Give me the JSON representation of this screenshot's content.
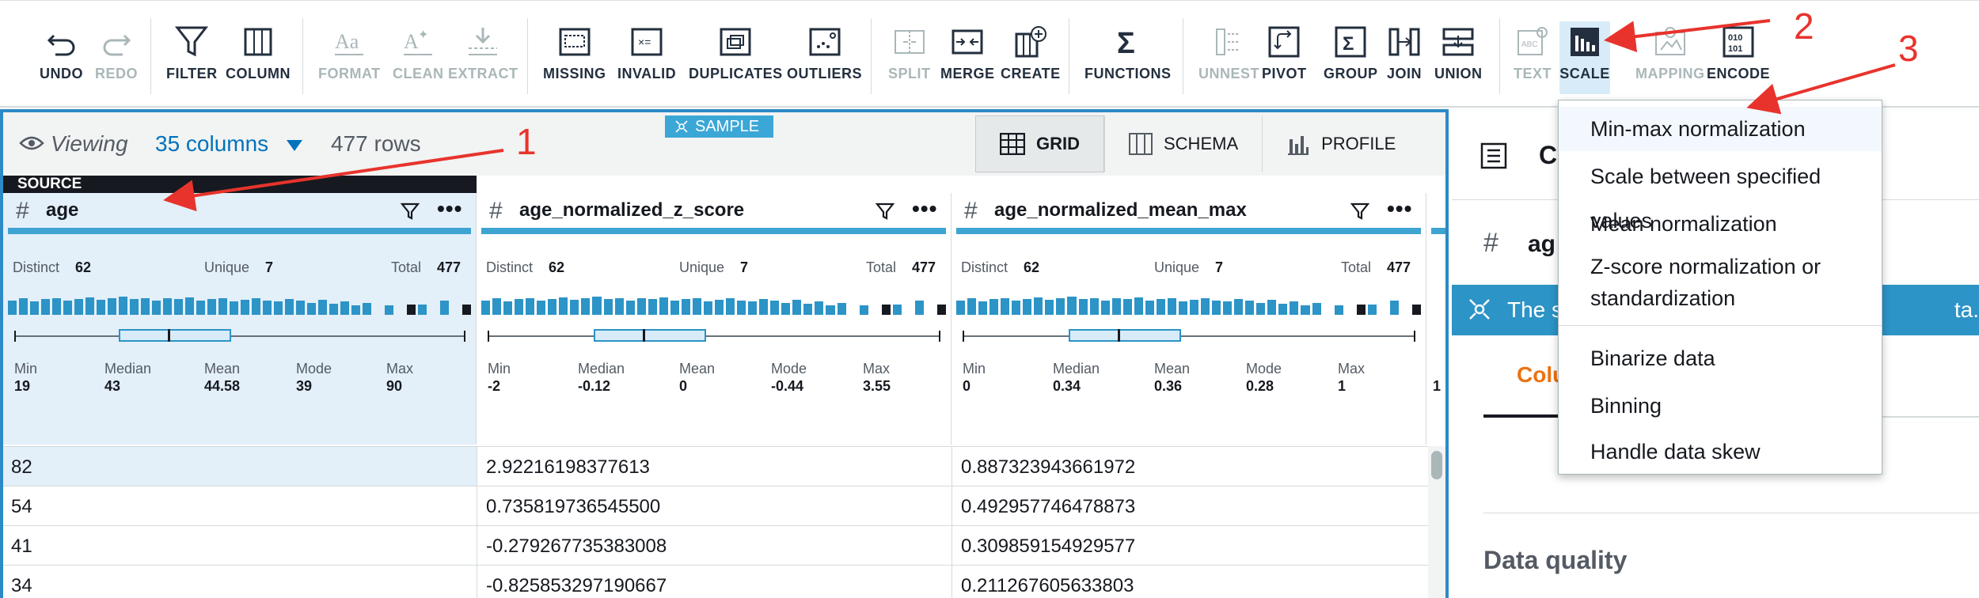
{
  "toolbar": {
    "undo": "UNDO",
    "redo": "REDO",
    "filter": "FILTER",
    "column": "COLUMN",
    "format": "FORMAT",
    "clean": "CLEAN",
    "extract": "EXTRACT",
    "missing": "MISSING",
    "invalid": "INVALID",
    "duplicates": "DUPLICATES",
    "outliers": "OUTLIERS",
    "split": "SPLIT",
    "merge": "MERGE",
    "create": "CREATE",
    "functions": "FUNCTIONS",
    "unnest": "UNNEST",
    "pivot": "PIVOT",
    "group": "GROUP",
    "join": "JOIN",
    "union": "UNION",
    "text": "TEXT",
    "scale": "SCALE",
    "mapping": "MAPPING",
    "encode": "ENCODE"
  },
  "viewbar": {
    "viewing": "Viewing",
    "columns": "35 columns",
    "rows": "477 rows",
    "sample": "SAMPLE",
    "tabs": [
      "GRID",
      "SCHEMA",
      "PROFILE"
    ]
  },
  "source_tag": "SOURCE",
  "columns": [
    {
      "name": "age",
      "distinct_label": "Distinct",
      "distinct": "62",
      "unique_label": "Unique",
      "unique": "7",
      "total_label": "Total",
      "total": "477",
      "stats": [
        {
          "label": "Min",
          "value": "19"
        },
        {
          "label": "Median",
          "value": "43"
        },
        {
          "label": "Mean",
          "value": "44.58"
        },
        {
          "label": "Mode",
          "value": "39"
        },
        {
          "label": "Max",
          "value": "90"
        }
      ]
    },
    {
      "name": "age_normalized_z_score",
      "distinct_label": "Distinct",
      "distinct": "62",
      "unique_label": "Unique",
      "unique": "7",
      "total_label": "Total",
      "total": "477",
      "stats": [
        {
          "label": "Min",
          "value": "-2"
        },
        {
          "label": "Median",
          "value": "-0.12"
        },
        {
          "label": "Mean",
          "value": "0"
        },
        {
          "label": "Mode",
          "value": "-0.44"
        },
        {
          "label": "Max",
          "value": "3.55"
        }
      ]
    },
    {
      "name": "age_normalized_mean_max",
      "distinct_label": "Distinct",
      "distinct": "62",
      "unique_label": "Unique",
      "unique": "7",
      "total_label": "Total",
      "total": "477",
      "stats": [
        {
          "label": "Min",
          "value": "0"
        },
        {
          "label": "Median",
          "value": "0.34"
        },
        {
          "label": "Mean",
          "value": "0.36"
        },
        {
          "label": "Mode",
          "value": "0.28"
        },
        {
          "label": "Max",
          "value": "1"
        }
      ]
    }
  ],
  "fourth_col_fragment": "1",
  "rows": [
    [
      "82",
      "2.92216198377613",
      "0.887323943661972"
    ],
    [
      "54",
      "0.735819736545500",
      "0.492957746478873"
    ],
    [
      "41",
      "-0.279267735383008",
      "0.309859154929577"
    ],
    [
      "34",
      "-0.825853297190667",
      "0.211267605633803"
    ]
  ],
  "right_panel": {
    "title_fragment": "C",
    "col_fragment": "ag",
    "banner_text": "The s",
    "banner_tail": "ta.",
    "tab_fragment": "Colu",
    "data_quality": "Data quality"
  },
  "dropdown": {
    "items": [
      "Min-max normalization",
      "Scale between specified values",
      "Mean normalization",
      "Z-score normalization or",
      "standardization",
      "Binarize data",
      "Binning",
      "Handle data skew"
    ]
  },
  "annotations": [
    "1",
    "2",
    "3"
  ],
  "colors": {
    "accent": "#2c94c6",
    "link": "#0073bb",
    "annotation": "#e8332c",
    "orange": "#ec7211"
  }
}
